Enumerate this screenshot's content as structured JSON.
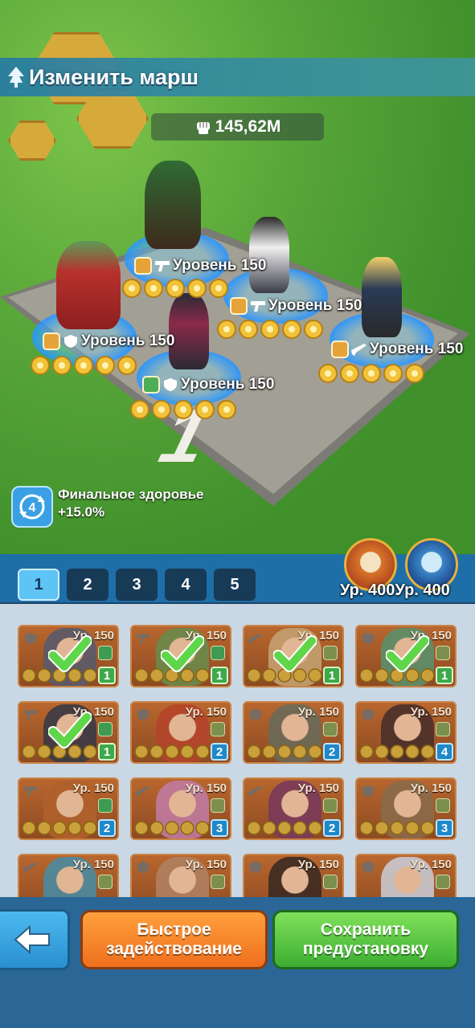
{
  "header": {
    "title": "Изменить марш"
  },
  "power": {
    "value": "145,62M"
  },
  "squad_heroes": [
    {
      "level_label": "Уровень 150",
      "class": "orange",
      "type": "gun",
      "stars": 5
    },
    {
      "level_label": "Уровень 150",
      "class": "orange",
      "type": "gun",
      "stars": 5
    },
    {
      "level_label": "Уровень 150",
      "class": "orange",
      "type": "shield",
      "stars": 5
    },
    {
      "level_label": "Уровень 150",
      "class": "orange",
      "type": "rifle",
      "stars": 5
    },
    {
      "level_label": "Уровень 150",
      "class": "green",
      "type": "shield",
      "stars": 5
    }
  ],
  "formation_number": "1",
  "bonus": {
    "badge": "4",
    "label": "Финальное здоровье",
    "value": "+15.0%"
  },
  "tabs": [
    "1",
    "2",
    "3",
    "4",
    "5"
  ],
  "pets": [
    {
      "label": "Ур. 400"
    },
    {
      "label": "Ур. 400"
    }
  ],
  "hero_cards": [
    {
      "level": "Ур. 150",
      "count": "1",
      "selected": true
    },
    {
      "level": "Ур. 150",
      "count": "1",
      "selected": true
    },
    {
      "level": "Ур. 150",
      "count": "1",
      "selected": true
    },
    {
      "level": "Ур. 150",
      "count": "1",
      "selected": true
    },
    {
      "level": "Ур. 150",
      "count": "1",
      "selected": true
    },
    {
      "level": "Ур. 150",
      "count": "2",
      "selected": false
    },
    {
      "level": "Ур. 150",
      "count": "2",
      "selected": false
    },
    {
      "level": "Ур. 150",
      "count": "4",
      "selected": false
    },
    {
      "level": "Ур. 150",
      "count": "2",
      "selected": false
    },
    {
      "level": "Ур. 150",
      "count": "3",
      "selected": false
    },
    {
      "level": "Ур. 150",
      "count": "2",
      "selected": false
    },
    {
      "level": "Ур. 150",
      "count": "3",
      "selected": false
    },
    {
      "level": "Ур. 150",
      "count": "",
      "selected": false
    },
    {
      "level": "Ур. 150",
      "count": "",
      "selected": false
    },
    {
      "level": "Ур. 150",
      "count": "",
      "selected": false
    },
    {
      "level": "Ур. 150",
      "count": "",
      "selected": false
    }
  ],
  "buttons": {
    "quick_deploy_line1": "Быстрое",
    "quick_deploy_line2": "задействование",
    "save_preset_line1": "Сохранить",
    "save_preset_line2": "предустановку"
  },
  "colors": {
    "accent_blue": "#5ec3f5",
    "orange": "#ef6f1e",
    "green": "#3cae32",
    "star": "#f2c23a"
  }
}
